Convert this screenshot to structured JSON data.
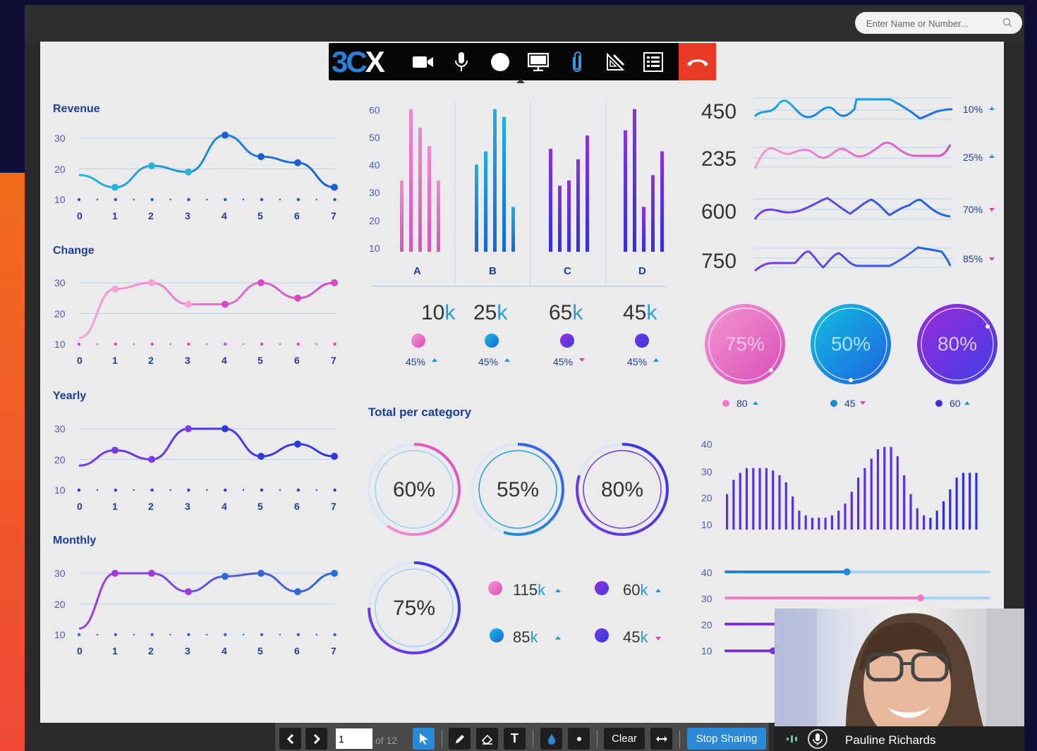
{
  "search": {
    "placeholder": "Enter Name or Number..."
  },
  "left_charts": [
    {
      "title": "Revenue",
      "yticks": [
        "30",
        "20",
        "10"
      ],
      "xticks": [
        "0",
        "1",
        "2",
        "3",
        "4",
        "5",
        "6",
        "7"
      ],
      "color": "#1a8bd0"
    },
    {
      "title": "Change",
      "yticks": [
        "30",
        "20",
        "10"
      ],
      "xticks": [
        "0",
        "1",
        "2",
        "3",
        "4",
        "5",
        "6",
        "7"
      ],
      "color": "#e46fc0"
    },
    {
      "title": "Yearly",
      "yticks": [
        "30",
        "20",
        "10"
      ],
      "xticks": [
        "0",
        "1",
        "2",
        "3",
        "4",
        "5",
        "6",
        "7"
      ],
      "color": "#6a3ae0"
    },
    {
      "title": "Monthly",
      "yticks": [
        "30",
        "20",
        "10"
      ],
      "xticks": [
        "0",
        "1",
        "2",
        "3",
        "4",
        "5",
        "6",
        "7"
      ],
      "color": "#5b4ad8"
    }
  ],
  "chart_data": [
    {
      "type": "line",
      "title": "Revenue",
      "x": [
        0,
        1,
        2,
        3,
        4,
        5,
        6,
        7
      ],
      "values": [
        18,
        14,
        21,
        19,
        31,
        24,
        22,
        14
      ],
      "ylim": [
        10,
        35
      ]
    },
    {
      "type": "line",
      "title": "Change",
      "x": [
        0,
        1,
        2,
        3,
        4,
        5,
        6,
        7
      ],
      "values": [
        12,
        28,
        30,
        23,
        23,
        30,
        25,
        30
      ],
      "ylim": [
        10,
        35
      ]
    },
    {
      "type": "line",
      "title": "Yearly",
      "x": [
        0,
        1,
        2,
        3,
        4,
        5,
        6,
        7
      ],
      "values": [
        18,
        23,
        20,
        30,
        30,
        21,
        25,
        21
      ],
      "ylim": [
        10,
        35
      ]
    },
    {
      "type": "line",
      "title": "Monthly",
      "x": [
        0,
        1,
        2,
        3,
        4,
        5,
        6,
        7
      ],
      "values": [
        12,
        30,
        30,
        24,
        29,
        30,
        24,
        30
      ],
      "ylim": [
        10,
        35
      ]
    },
    {
      "type": "bar",
      "categories": [
        "A",
        "B",
        "C",
        "D"
      ],
      "yticks": [
        "60",
        "50",
        "40",
        "30",
        "20",
        "10"
      ],
      "ylim": [
        5,
        60
      ],
      "series": [
        {
          "values": [
            32,
            59,
            52,
            45,
            32
          ]
        },
        {
          "values": [
            38,
            43,
            59,
            56,
            22
          ]
        },
        {
          "values": [
            44,
            30,
            32,
            40,
            49
          ]
        },
        {
          "values": [
            51,
            59,
            22,
            34,
            43
          ]
        }
      ]
    },
    {
      "type": "bar",
      "yticks": [
        "40",
        "30",
        "20",
        "10"
      ],
      "ylim": [
        5,
        42
      ],
      "values": [
        20,
        26,
        29,
        31,
        31,
        31,
        31,
        30,
        28,
        25,
        19,
        13,
        11,
        10,
        10,
        10,
        11,
        13,
        16,
        21,
        27,
        31,
        35,
        39,
        40,
        40,
        36,
        28,
        20,
        14,
        11,
        10,
        13,
        17,
        22,
        27,
        29,
        29,
        29
      ]
    }
  ],
  "kpis": [
    {
      "num": "10",
      "unit": "k",
      "pct": "45%",
      "dir": "up",
      "color": "#ef7cc4"
    },
    {
      "num": "25",
      "unit": "k",
      "pct": "45%",
      "dir": "up",
      "color": "#1a9fd8"
    },
    {
      "num": "65",
      "unit": "k",
      "pct": "45%",
      "dir": "down",
      "color": "#6a34e0"
    },
    {
      "num": "45",
      "unit": "k",
      "pct": "45%",
      "dir": "up",
      "color": "#7a3ad8"
    }
  ],
  "total_title": "Total per category",
  "donuts": [
    {
      "label": "60%",
      "pct": 0.6
    },
    {
      "label": "55%",
      "pct": 0.55
    },
    {
      "label": "80%",
      "pct": 0.8
    },
    {
      "label": "75%",
      "pct": 0.75
    }
  ],
  "mini_stats": [
    {
      "num": "115",
      "unit": "k",
      "dir": "up"
    },
    {
      "num": "60",
      "unit": "k",
      "dir": "up"
    },
    {
      "num": "85",
      "unit": "k",
      "dir": "up"
    },
    {
      "num": "45",
      "unit": "k",
      "dir": "down"
    }
  ],
  "sparks": [
    {
      "value": "450",
      "pct": "10%",
      "dir": "up"
    },
    {
      "value": "235",
      "pct": "25%",
      "dir": "up"
    },
    {
      "value": "600",
      "pct": "70%",
      "dir": "down"
    },
    {
      "value": "750",
      "pct": "85%",
      "dir": "down"
    }
  ],
  "gauges": [
    {
      "label": "75%",
      "pct": 0.75,
      "small": "80",
      "dir": "up"
    },
    {
      "label": "50%",
      "pct": 0.5,
      "small": "45",
      "dir": "down"
    },
    {
      "label": "80%",
      "pct": 0.8,
      "small": "60",
      "dir": "up"
    }
  ],
  "sliders": {
    "yticks": [
      "40",
      "30",
      "20",
      "10"
    ],
    "values": [
      0.46,
      0.74,
      0.2,
      0.18
    ]
  },
  "toolbar": {
    "page": "1",
    "of": "of 12",
    "clear": "Clear",
    "stop": "Stop Sharing"
  },
  "participant": {
    "name": "Pauline Richards"
  }
}
